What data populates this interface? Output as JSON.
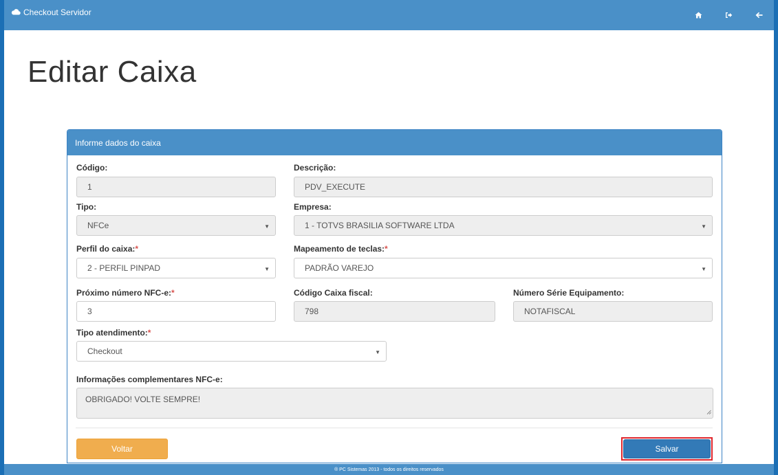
{
  "header": {
    "brand": "Checkout Servidor",
    "icons": [
      "home-icon",
      "sign-out-icon",
      "back-arrow-icon"
    ]
  },
  "page": {
    "title": "Editar Caixa"
  },
  "panel": {
    "heading": "Informe dados do caixa",
    "fields": {
      "codigo": {
        "label": "Código:",
        "value": "1"
      },
      "descricao": {
        "label": "Descrição:",
        "value": "PDV_EXECUTE"
      },
      "tipo": {
        "label": "Tipo:",
        "value": "NFCe"
      },
      "empresa": {
        "label": "Empresa:",
        "value": "1 - TOTVS BRASILIA SOFTWARE LTDA"
      },
      "perfil": {
        "label": "Perfil do caixa:",
        "required_mark": "*",
        "value": "2 - PERFIL PINPAD"
      },
      "mapeamento": {
        "label": "Mapeamento de teclas:",
        "required_mark": "*",
        "value": "PADRÃO VAREJO"
      },
      "proximo_nfce": {
        "label": "Próximo número NFC-e:",
        "required_mark": "*",
        "value": "3"
      },
      "codigo_fiscal": {
        "label": "Código Caixa fiscal:",
        "value": "798"
      },
      "numero_serie": {
        "label": "Número Série Equipamento:",
        "value": "NOTAFISCAL"
      },
      "tipo_atendimento": {
        "label": "Tipo atendimento:",
        "required_mark": "*",
        "value": "Checkout"
      },
      "info_complementares": {
        "label": "Informações complementares NFC-e:",
        "value": "OBRIGADO! VOLTE SEMPRE!"
      }
    },
    "buttons": {
      "back": "Voltar",
      "save": "Salvar"
    }
  },
  "footer": {
    "text": "® PC Sistemas 2013 - todos os direitos reservados"
  },
  "colors": {
    "header_bg": "#4a90c8",
    "frame": "#1b6fb5",
    "back_button": "#f0ad4e",
    "save_button": "#337ab7",
    "highlight": "#e0252b",
    "required": "#d9534f"
  }
}
